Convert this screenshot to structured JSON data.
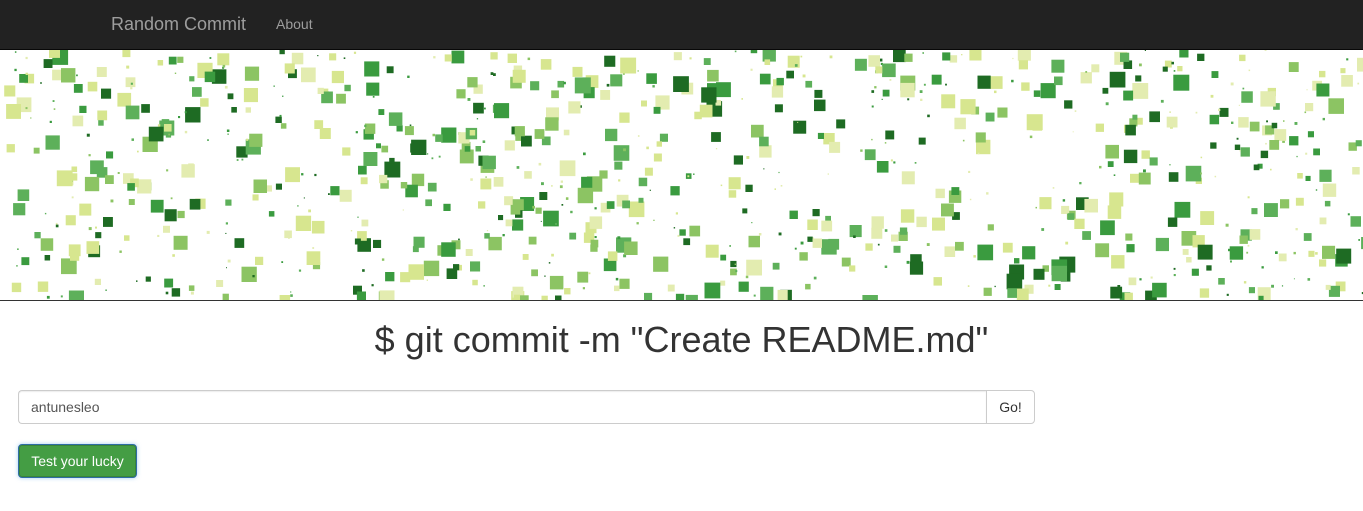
{
  "navbar": {
    "brand": "Random Commit",
    "links": [
      {
        "label": "About"
      }
    ]
  },
  "banner": {
    "palette": [
      "#1e6b23",
      "#3a9b3f",
      "#8cc463",
      "#d7e68f",
      "#e3ecb0",
      "#5db05a"
    ]
  },
  "main": {
    "commit_message": "$ git commit -m \"Create README.md\""
  },
  "search": {
    "value": "antunesleo",
    "go_label": "Go!"
  },
  "lucky_button": {
    "label": "Test your lucky"
  }
}
